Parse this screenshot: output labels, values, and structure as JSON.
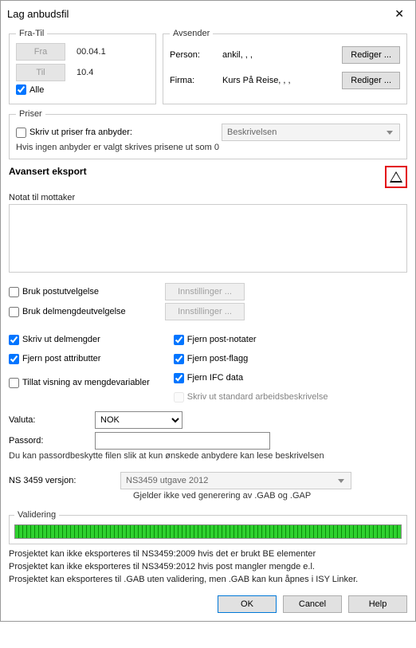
{
  "window": {
    "title": "Lag anbudsfil"
  },
  "fra_til": {
    "legend": "Fra-Til",
    "fra_btn": "Fra",
    "fra_val": "00.04.1",
    "til_btn": "Til",
    "til_val": "10.4",
    "alle": "Alle"
  },
  "avsender": {
    "legend": "Avsender",
    "person_lbl": "Person:",
    "person_val": "ankil, , ,",
    "firma_lbl": "Firma:",
    "firma_val": "Kurs På Reise, , ,",
    "rediger": "Rediger ..."
  },
  "priser": {
    "legend": "Priser",
    "skriv_label": "Skriv ut priser fra anbyder:",
    "beskrivelsen": "Beskrivelsen",
    "note": "Hvis ingen anbyder er valgt skrives prisene ut som 0"
  },
  "avansert": {
    "title": "Avansert eksport",
    "notat_label": "Notat til mottaker",
    "notat_value": "",
    "bruk_post": "Bruk postutvelgelse",
    "bruk_del": "Bruk delmengdeutvelgelse",
    "innstillinger": "Innstillinger ...",
    "skriv_del": "Skriv ut delmengder",
    "fjern_attr": "Fjern post attributter",
    "tillat_mv": "Tillat visning av mengdevariabler",
    "fjern_notater": "Fjern post-notater",
    "fjern_flagg": "Fjern post-flagg",
    "fjern_ifc": "Fjern IFC data",
    "skriv_std": "Skriv ut standard arbeidsbeskrivelse",
    "valuta_lbl": "Valuta:",
    "valuta_val": "NOK",
    "passord_lbl": "Passord:",
    "passord_val": "",
    "passord_hint": "Du kan passordbeskytte filen slik at kun ønskede anbydere kan lese beskrivelsen",
    "ns_lbl": "NS 3459 versjon:",
    "ns_val": "NS3459 utgave 2012",
    "ns_note": "Gjelder ikke ved generering av .GAB og .GAP"
  },
  "validering": {
    "legend": "Validering",
    "msgs": [
      "Prosjektet kan ikke eksporteres til NS3459:2009 hvis det er brukt BE elementer",
      "Prosjektet kan ikke eksporteres til NS3459:2012 hvis post mangler mengde e.l.",
      "Prosjektet kan eksporteres til .GAB uten validering, men .GAB kan kun åpnes i ISY Linker."
    ]
  },
  "buttons": {
    "ok": "OK",
    "cancel": "Cancel",
    "help": "Help"
  }
}
